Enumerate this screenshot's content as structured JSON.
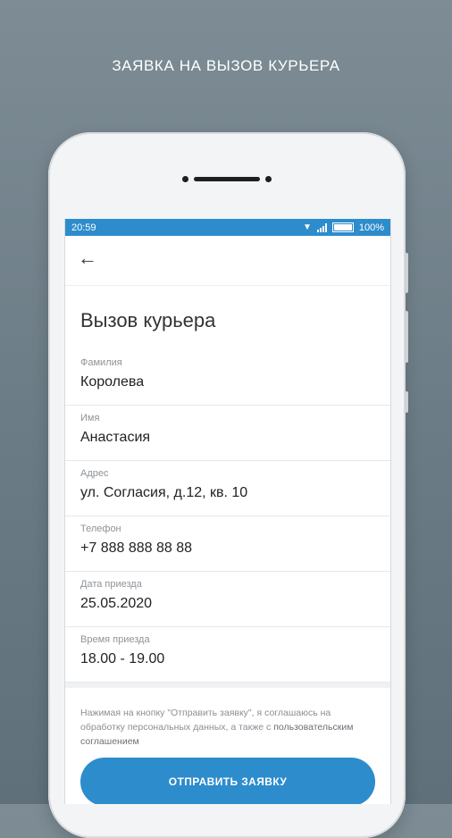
{
  "promo": {
    "title": "ЗАЯВКА НА ВЫЗОВ КУРЬЕРА"
  },
  "status_bar": {
    "time": "20:59",
    "battery": "100%",
    "wifi_icon": "wifi-icon",
    "signal_icon": "signal-icon",
    "battery_icon": "battery-icon"
  },
  "app_bar": {
    "back_icon": "arrow-back-icon"
  },
  "page": {
    "title": "Вызов курьера"
  },
  "form": {
    "fields": [
      {
        "label": "Фамилия",
        "value": "Королева"
      },
      {
        "label": "Имя",
        "value": "Анастасия"
      },
      {
        "label": "Адрес",
        "value": "ул. Согласия, д.12, кв. 10"
      },
      {
        "label": "Телефон",
        "value": "+7 888 888 88 88"
      },
      {
        "label": "Дата приезда",
        "value": "25.05.2020"
      },
      {
        "label": "Время приезда",
        "value": "18.00 - 19.00"
      }
    ]
  },
  "agreement": {
    "text": "Нажимая на кнопку \"Отправить заявку\", я соглашаюсь на обработку персональных данных, а также с",
    "link": "пользовательским соглашением"
  },
  "submit": {
    "label": "ОТПРАВИТЬ ЗАЯВКУ"
  },
  "colors": {
    "accent": "#2d8ccc",
    "background": "#6b7b85"
  }
}
